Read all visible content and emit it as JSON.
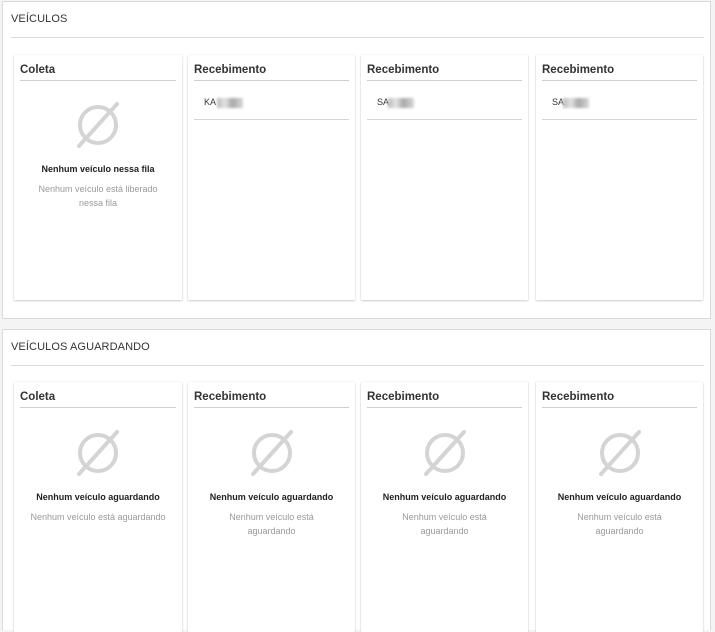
{
  "sections": {
    "veiculos": {
      "title": "VEÍCULOS",
      "cards": [
        {
          "title": "Coleta",
          "empty_title": "Nenhum veículo nessa fila",
          "empty_sub": "Nenhum veículo está liberado nessa fila"
        },
        {
          "title": "Recebimento",
          "row_prefix": "KA"
        },
        {
          "title": "Recebimento",
          "row_prefix": "SA"
        },
        {
          "title": "Recebimento",
          "row_prefix": "SA"
        }
      ]
    },
    "aguardando": {
      "title": "VEÍCULOS AGUARDANDO",
      "cards": [
        {
          "title": "Coleta",
          "empty_title": "Nenhum veículo aguardando",
          "empty_sub": "Nenhum veículo está aguardando"
        },
        {
          "title": "Recebimento",
          "empty_title": "Nenhum veículo aguardando",
          "empty_sub": "Nenhum veículo está aguardando"
        },
        {
          "title": "Recebimento",
          "empty_title": "Nenhum veículo aguardando",
          "empty_sub": "Nenhum veículo está aguardando"
        },
        {
          "title": "Recebimento",
          "empty_title": "Nenhum veículo aguardando",
          "empty_sub": "Nenhum veículo está aguardando"
        }
      ]
    }
  },
  "icons": {
    "empty": "empty-set-icon"
  },
  "colors": {
    "icon": "#d4d4d4",
    "muted_text": "#9a9a9a"
  }
}
